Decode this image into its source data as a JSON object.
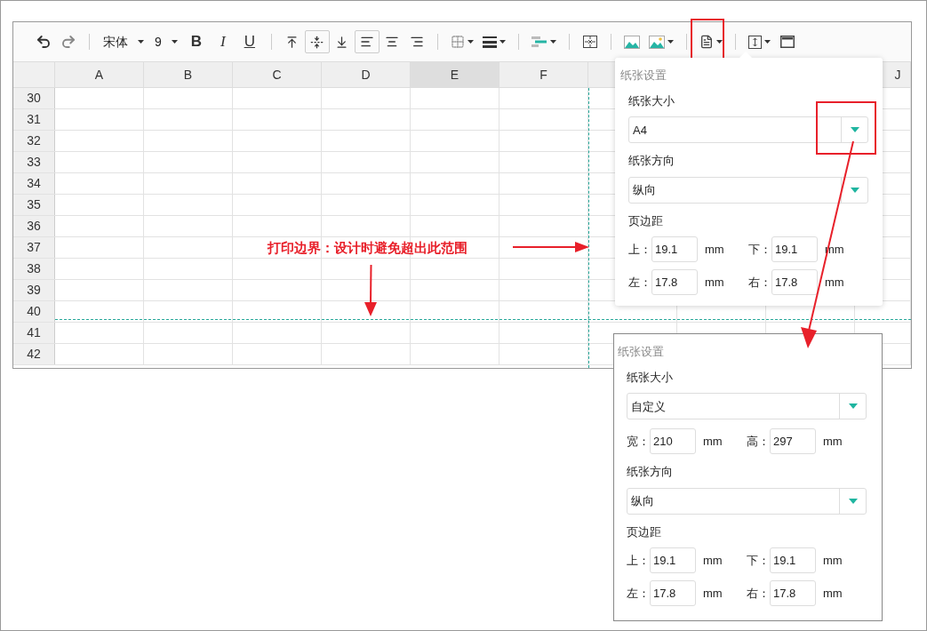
{
  "toolbar": {
    "font": "宋体",
    "font_size": "9",
    "style_buttons": [
      "B",
      "I",
      "U"
    ],
    "vertical_align": [
      {
        "selected": false
      },
      {
        "selected": true
      },
      {
        "selected": false
      }
    ],
    "horizontal_align": [
      {
        "selected": true
      },
      {
        "selected": false
      },
      {
        "selected": false
      }
    ],
    "paper_button_highlighted": true
  },
  "sheet": {
    "columns": [
      {
        "label": "A",
        "selected": false
      },
      {
        "label": "B",
        "selected": false
      },
      {
        "label": "C",
        "selected": false
      },
      {
        "label": "D",
        "selected": false
      },
      {
        "label": "E",
        "selected": true
      },
      {
        "label": "F",
        "selected": false
      },
      {},
      {},
      {},
      {
        "label": "J",
        "selected": false
      }
    ],
    "rows": [
      "30",
      "31",
      "32",
      "33",
      "34",
      "35",
      "36",
      "37",
      "38",
      "39",
      "40",
      "41",
      "42"
    ],
    "print_boundary": true
  },
  "annotation": {
    "text": "打印边界：设计时避免超出此范围"
  },
  "panels": [
    {
      "title": "纸张设置",
      "paper_size": {
        "label": "纸张大小",
        "value": "A4",
        "highlighted": true
      },
      "orientation": {
        "label": "纸张方向",
        "value": "纵向"
      },
      "margins": {
        "label": "页边距",
        "fields": [
          {
            "label": "上：",
            "value": "19.1",
            "unit": "mm"
          },
          {
            "label": "下：",
            "value": "19.1",
            "unit": "mm"
          },
          {
            "label": "左：",
            "value": "17.8",
            "unit": "mm"
          },
          {
            "label": "右：",
            "value": "17.8",
            "unit": "mm"
          }
        ]
      }
    },
    {
      "title": "纸张设置",
      "paper_size": {
        "label": "纸张大小",
        "value": "自定义",
        "highlighted": false
      },
      "custom_size": [
        {
          "label": "宽：",
          "value": "210",
          "unit": "mm"
        },
        {
          "label": "高：",
          "value": "297",
          "unit": "mm"
        }
      ],
      "orientation": {
        "label": "纸张方向",
        "value": "纵向"
      },
      "margins": {
        "label": "页边距",
        "fields": [
          {
            "label": "上：",
            "value": "19.1",
            "unit": "mm"
          },
          {
            "label": "下：",
            "value": "19.1",
            "unit": "mm"
          },
          {
            "label": "左：",
            "value": "17.8",
            "unit": "mm"
          },
          {
            "label": "右：",
            "value": "17.8",
            "unit": "mm"
          }
        ]
      }
    }
  ]
}
